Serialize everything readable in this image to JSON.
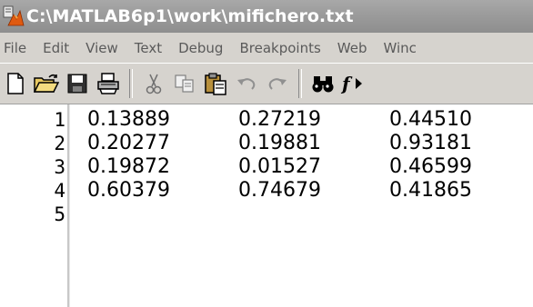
{
  "window": {
    "title": "C:\\MATLAB6p1\\work\\mifichero.txt"
  },
  "menu": {
    "items": [
      "File",
      "Edit",
      "View",
      "Text",
      "Debug",
      "Breakpoints",
      "Web",
      "Winc"
    ]
  },
  "toolbar": {
    "icons": [
      "new-document-icon",
      "open-folder-icon",
      "save-icon",
      "print-icon",
      "cut-icon",
      "copy-icon",
      "paste-icon",
      "undo-icon",
      "redo-icon",
      "find-icon",
      "function-icon"
    ]
  },
  "editor": {
    "line_numbers": [
      "1",
      "2",
      "3",
      "4",
      "5"
    ],
    "rows": [
      [
        "0.13889",
        "0.27219",
        "0.44510"
      ],
      [
        "0.20277",
        "0.19881",
        "0.93181"
      ],
      [
        "0.19872",
        "0.01527",
        "0.46599"
      ],
      [
        "0.60379",
        "0.74679",
        "0.41865"
      ],
      []
    ]
  },
  "colors": {
    "title_bar": "#9a9a9a",
    "chrome": "#d6d3ce",
    "editor_bg": "#ffffff"
  }
}
